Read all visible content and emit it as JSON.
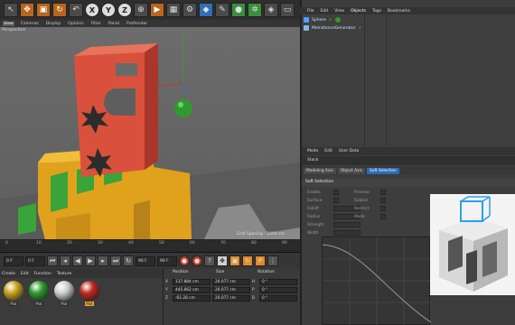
{
  "viewport": {
    "menu": [
      "View",
      "Cameras",
      "Display",
      "Options",
      "Filter",
      "Panel",
      "ProRender"
    ],
    "active_menu": 0,
    "label": "Perspective",
    "grid_spacing": "Grid Spacing : 1000 cm"
  },
  "timeline": {
    "ticks": [
      "0",
      "10",
      "20",
      "30",
      "40",
      "50",
      "60",
      "70",
      "80",
      "90"
    ]
  },
  "transport": {
    "start": "0 F",
    "current": "0 F",
    "end": "90 F",
    "end2": "90 F"
  },
  "materials": {
    "menu": [
      "Create",
      "Edit",
      "Function",
      "Texture"
    ],
    "items": [
      {
        "name": "Mat",
        "color": "#c9a21f",
        "selected": false
      },
      {
        "name": "Mat",
        "color": "#2f9a2f",
        "selected": false
      },
      {
        "name": "Mat",
        "color": "#cfcfcf",
        "selected": false
      },
      {
        "name": "Mat",
        "color": "#c02a1e",
        "selected": true
      }
    ]
  },
  "coordinates": {
    "headers": [
      "Position",
      "Size",
      "Rotation"
    ],
    "rows": [
      {
        "axis": "X",
        "position": "137.884 cm",
        "size": "20.077 cm",
        "rot_axis": "H",
        "rotation": "0 °"
      },
      {
        "axis": "Y",
        "position": "445.662 cm",
        "size": "20.077 cm",
        "rot_axis": "P",
        "rotation": "0 °"
      },
      {
        "axis": "Z",
        "position": "-61.28 cm",
        "size": "20.077 cm",
        "rot_axis": "B",
        "rotation": "0 °"
      }
    ]
  },
  "object_manager": {
    "menu": [
      "File",
      "Edit",
      "View",
      "Objects",
      "Tags",
      "Bookmarks"
    ],
    "active_menu": 3,
    "objects": [
      {
        "name": "Sphere",
        "icon_color": "#4aa3ff"
      },
      {
        "name": "MoInstanceGenerator",
        "icon_color": "#8ab4e0"
      }
    ]
  },
  "attribute_manager": {
    "menu": [
      "Mode",
      "Edit",
      "User Data"
    ],
    "title": "Stack",
    "tabs": [
      "Modeling Axis",
      "Object Axis",
      "Soft Selection"
    ],
    "active_tab": 2,
    "section": "Soft Selection",
    "params_left": [
      "Enable",
      "Surface",
      "Falloff",
      "Radius",
      "Strength",
      "Width"
    ],
    "params_right": [
      "Preview",
      "Rubber",
      "Restrict",
      "Mode"
    ]
  },
  "colors": {
    "accent": "#2c6bb5",
    "toolbar_orange": "#b9651d",
    "red_block": "#d9513c",
    "yellow_block": "#e0a21c",
    "green_block": "#3aa33a"
  }
}
